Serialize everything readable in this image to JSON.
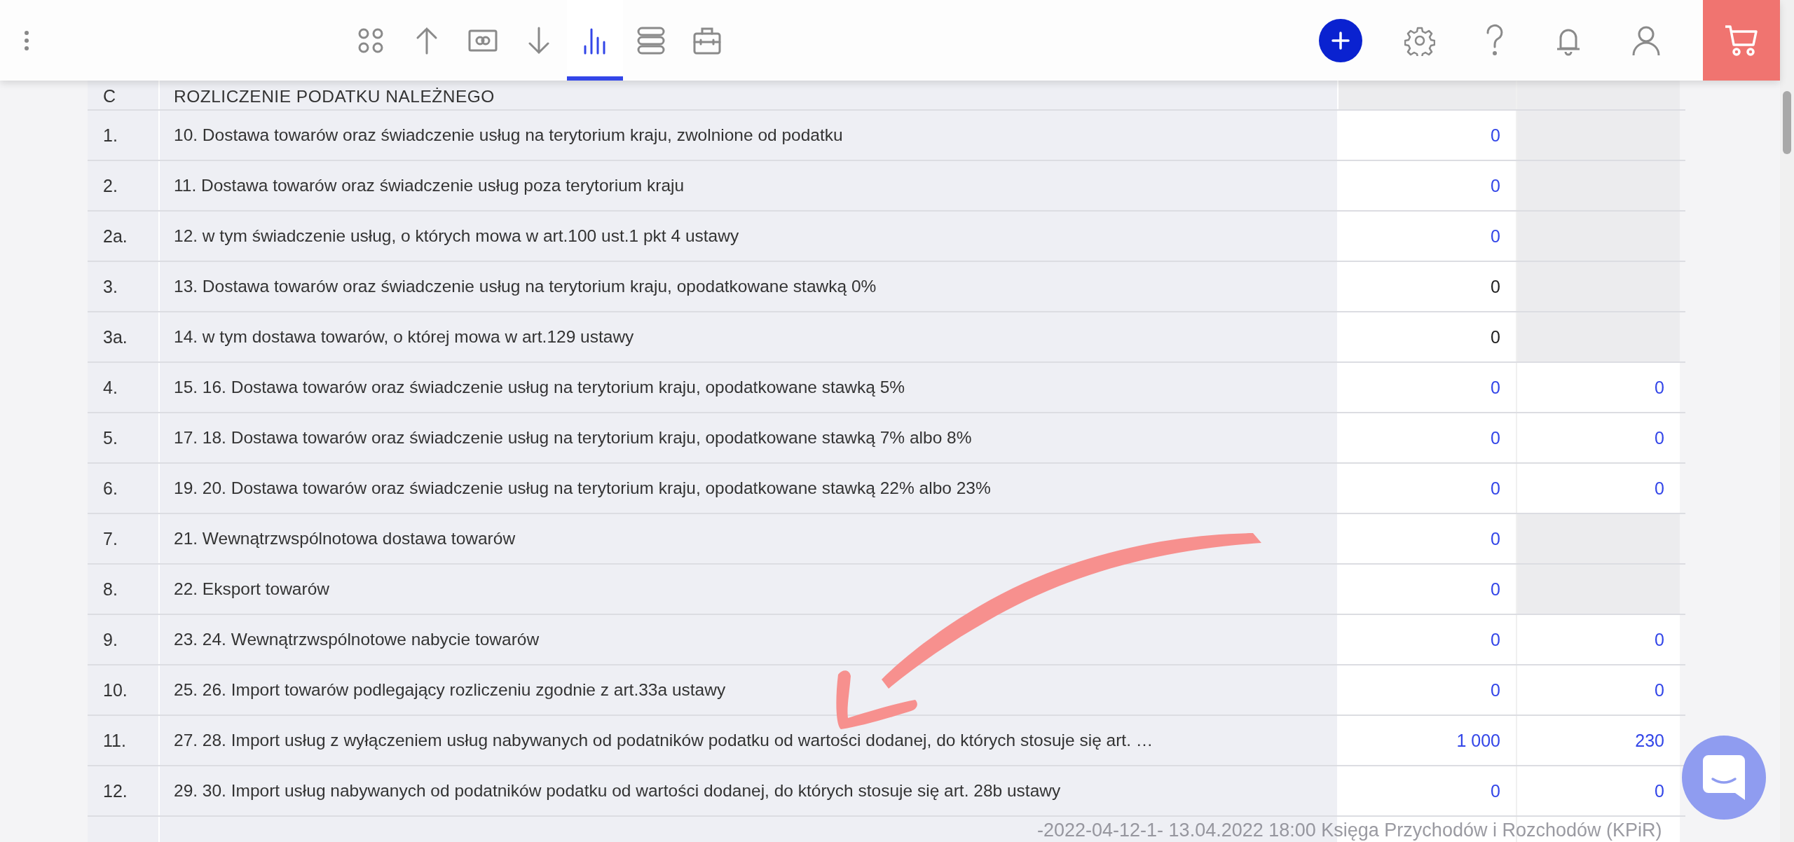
{
  "nav_tabs": [
    {
      "selected": false
    },
    {
      "selected": false
    },
    {
      "selected": false
    },
    {
      "selected": false
    },
    {
      "selected": true
    },
    {
      "selected": false
    },
    {
      "selected": false
    }
  ],
  "table": {
    "header": {
      "no": "C",
      "label": "ROZLICZENIE PODATKU NALEŻNEGO"
    },
    "rows": [
      {
        "no": "1.",
        "label": "10. Dostawa towarów oraz świadczenie usług na terytorium kraju, zwolnione od podatku",
        "amount": {
          "text": "0",
          "linked": true
        },
        "tax_available": false
      },
      {
        "no": "2.",
        "label": "11. Dostawa towarów oraz świadczenie usług poza terytorium kraju",
        "amount": {
          "text": "0",
          "linked": true
        },
        "tax_available": false
      },
      {
        "no": "2a.",
        "label": "12. w tym świadczenie usług, o których mowa w art.100 ust.1 pkt 4 ustawy",
        "amount": {
          "text": "0",
          "linked": true
        },
        "tax_available": false
      },
      {
        "no": "3.",
        "label": "13. Dostawa towarów oraz świadczenie usług na terytorium kraju, opodatkowane stawką 0%",
        "amount": {
          "text": "0",
          "linked": false
        },
        "tax_available": false
      },
      {
        "no": "3a.",
        "label": "14. w tym dostawa towarów, o której mowa w art.129 ustawy",
        "amount": {
          "text": "0",
          "linked": false
        },
        "tax_available": false
      },
      {
        "no": "4.",
        "label": "15. 16. Dostawa towarów oraz świadczenie usług na terytorium kraju, opodatkowane stawką 5%",
        "amount": {
          "text": "0",
          "linked": true
        },
        "tax_available": true,
        "tax": {
          "text": "0",
          "linked": true
        }
      },
      {
        "no": "5.",
        "label": "17. 18. Dostawa towarów oraz świadczenie usług na terytorium kraju, opodatkowane stawką 7% albo 8%",
        "amount": {
          "text": "0",
          "linked": true
        },
        "tax_available": true,
        "tax": {
          "text": "0",
          "linked": true
        }
      },
      {
        "no": "6.",
        "label": "19. 20. Dostawa towarów oraz świadczenie usług na terytorium kraju, opodatkowane stawką 22% albo 23%",
        "amount": {
          "text": "0",
          "linked": true
        },
        "tax_available": true,
        "tax": {
          "text": "0",
          "linked": true
        }
      },
      {
        "no": "7.",
        "label": "21. Wewnątrzwspólnotowa dostawa towarów",
        "amount": {
          "text": "0",
          "linked": true
        },
        "tax_available": false
      },
      {
        "no": "8.",
        "label": "22. Eksport towarów",
        "amount": {
          "text": "0",
          "linked": true
        },
        "tax_available": false
      },
      {
        "no": "9.",
        "label": "23. 24. Wewnątrzwspólnotowe nabycie towarów",
        "amount": {
          "text": "0",
          "linked": true
        },
        "tax_available": true,
        "tax": {
          "text": "0",
          "linked": true
        }
      },
      {
        "no": "10.",
        "label": "25. 26. Import towarów podlegający rozliczeniu zgodnie z art.33a ustawy",
        "amount": {
          "text": "0",
          "linked": true
        },
        "tax_available": true,
        "tax": {
          "text": "0",
          "linked": true
        }
      },
      {
        "no": "11.",
        "label": "27. 28. Import usług z wyłączeniem usług nabywanych od podatników podatku od wartości dodanej, do których stosuje się art. …",
        "amount": {
          "text": "1 000",
          "linked": true
        },
        "tax_available": true,
        "tax": {
          "text": "230",
          "linked": true
        }
      },
      {
        "no": "12.",
        "label": "29. 30. Import usług nabywanych od podatników podatku od wartości dodanej, do których stosuje się art. 28b ustawy",
        "amount": {
          "text": "0",
          "linked": true
        },
        "tax_available": true,
        "tax": {
          "text": "0",
          "linked": true
        }
      }
    ]
  },
  "footer_note": "-2022-04-12-1- 13.04.2022 18:00 Księga Przychodów i Rozchodów (KPiR)"
}
